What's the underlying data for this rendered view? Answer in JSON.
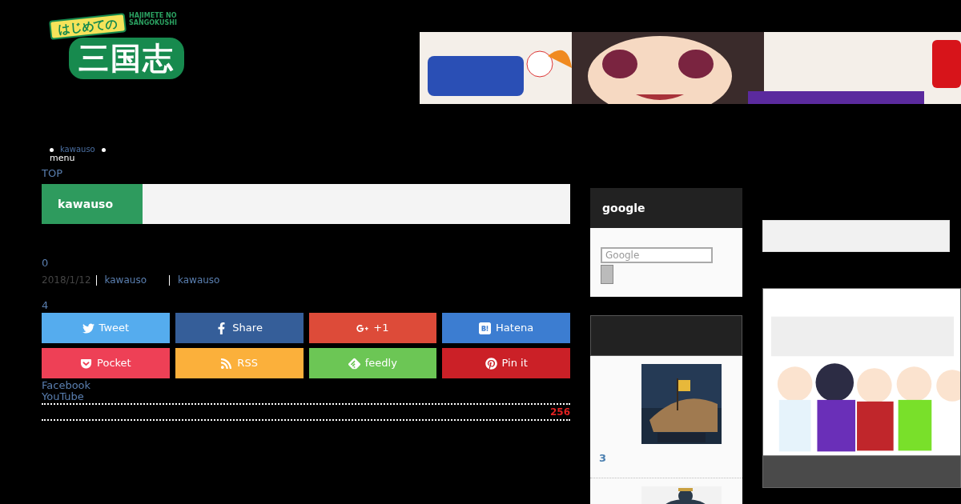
{
  "logo": {
    "small": "はじめての",
    "big": "三国志",
    "romaji": [
      "HAJIMETE NO",
      "SANGOKUSHI"
    ]
  },
  "header_ad": {
    "kind": "picture"
  },
  "breadcrumb": {
    "link": "kawauso",
    "menu": "menu"
  },
  "top_link": "TOP",
  "tabs": [
    {
      "label": "kawauso",
      "selected": true
    }
  ],
  "post": {
    "count": "0",
    "date": "2018/1/12",
    "author": "kawauso",
    "category": "kawauso",
    "share_count": "4"
  },
  "share_buttons": [
    {
      "kind": "twitter",
      "label": "Tweet",
      "color": "#55acee"
    },
    {
      "kind": "facebook",
      "label": "Share",
      "color": "#355e99"
    },
    {
      "kind": "googleplus",
      "label": "+1",
      "color": "#dd4b39"
    },
    {
      "kind": "hatena",
      "label": "Hatena",
      "color": "#3c7dd1"
    },
    {
      "kind": "pocket",
      "label": "Pocket",
      "color": "#ee4056"
    },
    {
      "kind": "rss",
      "label": "RSS",
      "color": "#fbb03b"
    },
    {
      "kind": "feedly",
      "label": "feedly",
      "color": "#6cc655"
    },
    {
      "kind": "pinterest",
      "label": "Pin it",
      "color": "#cb2027"
    }
  ],
  "follow_links": [
    "Facebook",
    "YouTube"
  ],
  "total_count": "256",
  "sidebar": {
    "search_widget": {
      "title": "google",
      "placeholder": "Google"
    },
    "ranking_widget": {
      "items": [
        {
          "kind": "picture",
          "rank": "3"
        },
        {
          "kind": "picture"
        }
      ]
    }
  },
  "right_ad": {
    "kind": "picture"
  }
}
